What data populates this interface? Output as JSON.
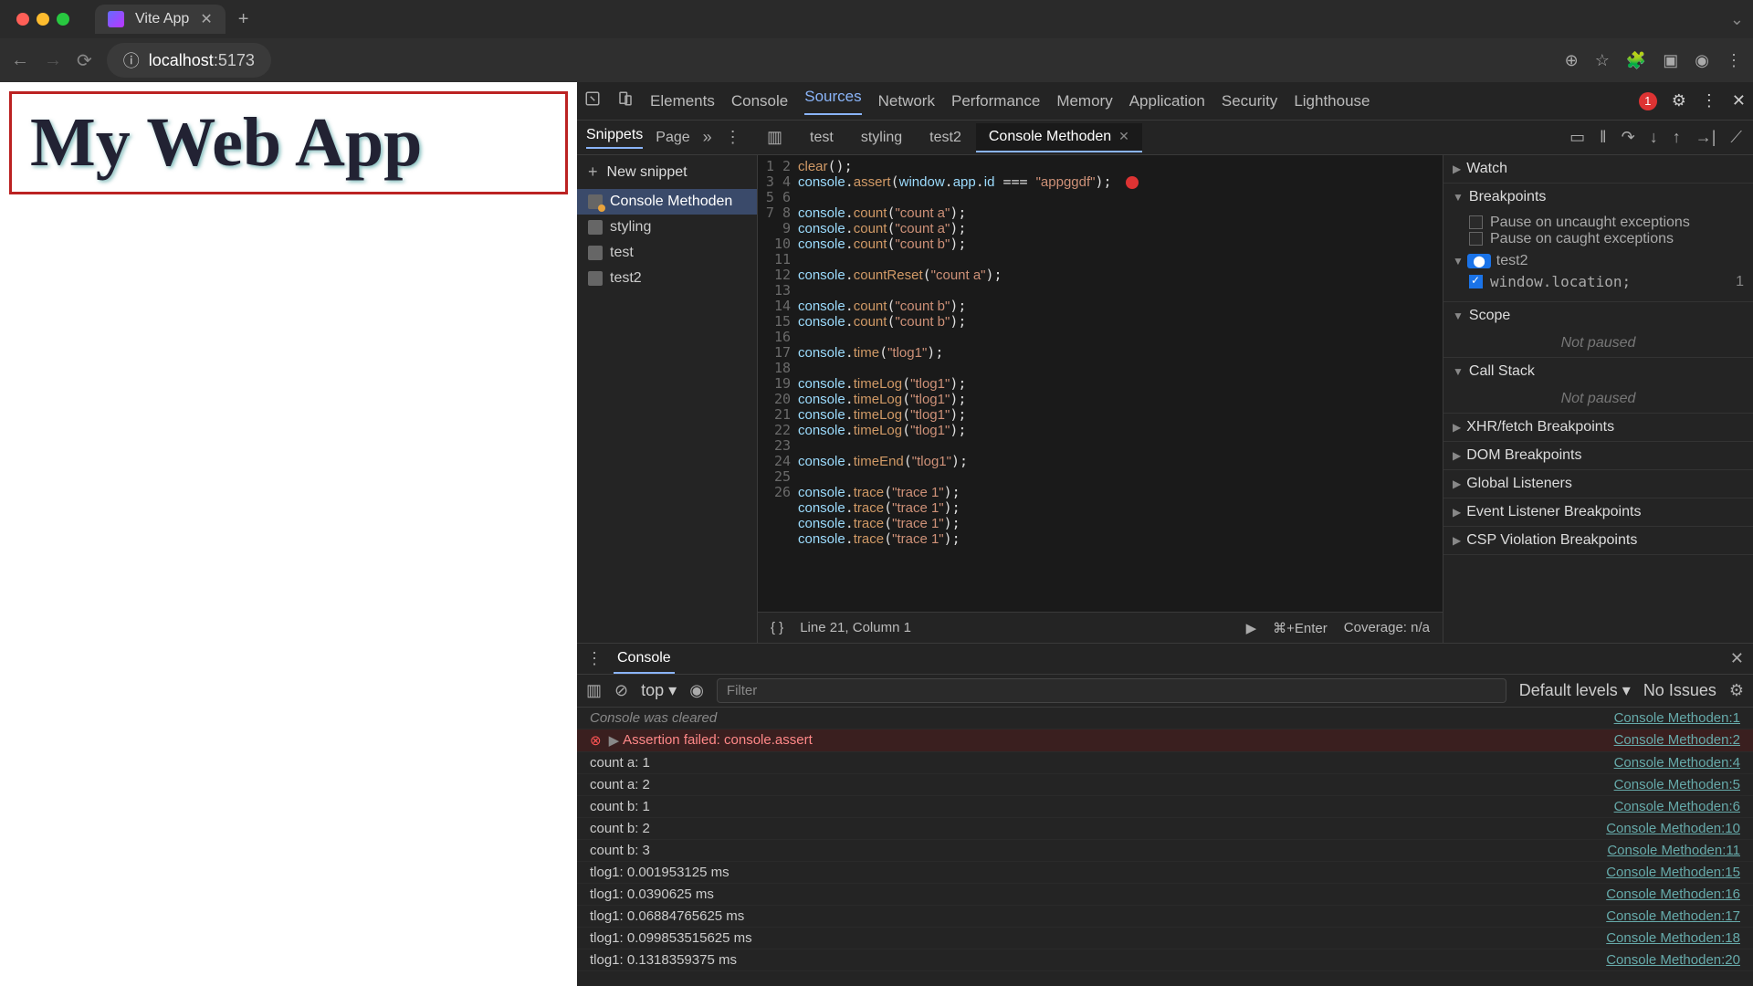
{
  "browser": {
    "tab_title": "Vite App",
    "url_prefix": "localhost",
    "url_suffix": ":5173"
  },
  "page": {
    "heading": "My Web App"
  },
  "devtools": {
    "tabs": [
      "Elements",
      "Console",
      "Sources",
      "Network",
      "Performance",
      "Memory",
      "Application",
      "Security",
      "Lighthouse"
    ],
    "active_tab": "Sources",
    "error_count": "1"
  },
  "sources": {
    "left_tabs": [
      "Snippets",
      "Page"
    ],
    "new_snippet": "New snippet",
    "snippets": [
      "Console Methoden",
      "styling",
      "test",
      "test2"
    ],
    "selected_snippet": "Console Methoden",
    "file_tabs": [
      "test",
      "styling",
      "test2",
      "Console Methoden"
    ],
    "active_file": "Console Methoden",
    "code_lines": [
      {
        "n": 1,
        "html": "<span class='tok-fn'>clear</span>();"
      },
      {
        "n": 2,
        "html": "<span class='tok-obj'>console</span>.<span class='tok-fn'>assert</span>(<span class='tok-obj'>window</span>.<span class='tok-obj'>app</span>.<span class='tok-obj'>id</span> === <span class='tok-str'>\"appggdf\"</span>); <span class='err-dot'></span>"
      },
      {
        "n": 3,
        "html": ""
      },
      {
        "n": 4,
        "html": "<span class='tok-obj'>console</span>.<span class='tok-fn'>count</span>(<span class='tok-str'>\"count a\"</span>);"
      },
      {
        "n": 5,
        "html": "<span class='tok-obj'>console</span>.<span class='tok-fn'>count</span>(<span class='tok-str'>\"count a\"</span>);"
      },
      {
        "n": 6,
        "html": "<span class='tok-obj'>console</span>.<span class='tok-fn'>count</span>(<span class='tok-str'>\"count b\"</span>);"
      },
      {
        "n": 7,
        "html": ""
      },
      {
        "n": 8,
        "html": "<span class='tok-obj'>console</span>.<span class='tok-fn'>countReset</span>(<span class='tok-str'>\"count a\"</span>);"
      },
      {
        "n": 9,
        "html": ""
      },
      {
        "n": 10,
        "html": "<span class='tok-obj'>console</span>.<span class='tok-fn'>count</span>(<span class='tok-str'>\"count b\"</span>);"
      },
      {
        "n": 11,
        "html": "<span class='tok-obj'>console</span>.<span class='tok-fn'>count</span>(<span class='tok-str'>\"count b\"</span>);"
      },
      {
        "n": 12,
        "html": ""
      },
      {
        "n": 13,
        "html": "<span class='tok-obj'>console</span>.<span class='tok-fn'>time</span>(<span class='tok-str'>\"tlog1\"</span>);"
      },
      {
        "n": 14,
        "html": ""
      },
      {
        "n": 15,
        "html": "<span class='tok-obj'>console</span>.<span class='tok-fn'>timeLog</span>(<span class='tok-str'>\"tlog1\"</span>);"
      },
      {
        "n": 16,
        "html": "<span class='tok-obj'>console</span>.<span class='tok-fn'>timeLog</span>(<span class='tok-str'>\"tlog1\"</span>);"
      },
      {
        "n": 17,
        "html": "<span class='tok-obj'>console</span>.<span class='tok-fn'>timeLog</span>(<span class='tok-str'>\"tlog1\"</span>);"
      },
      {
        "n": 18,
        "html": "<span class='tok-obj'>console</span>.<span class='tok-fn'>timeLog</span>(<span class='tok-str'>\"tlog1\"</span>);"
      },
      {
        "n": 19,
        "html": ""
      },
      {
        "n": 20,
        "html": "<span class='tok-obj'>console</span>.<span class='tok-fn'>timeEnd</span>(<span class='tok-str'>\"tlog1\"</span>);"
      },
      {
        "n": 21,
        "html": ""
      },
      {
        "n": 22,
        "html": "<span class='tok-obj'>console</span>.<span class='tok-fn'>trace</span>(<span class='tok-str'>\"trace 1\"</span>);"
      },
      {
        "n": 23,
        "html": "<span class='tok-obj'>console</span>.<span class='tok-fn'>trace</span>(<span class='tok-str'>\"trace 1\"</span>);"
      },
      {
        "n": 24,
        "html": "<span class='tok-obj'>console</span>.<span class='tok-fn'>trace</span>(<span class='tok-str'>\"trace 1\"</span>);"
      },
      {
        "n": 25,
        "html": "<span class='tok-obj'>console</span>.<span class='tok-fn'>trace</span>(<span class='tok-str'>\"trace 1\"</span>);"
      },
      {
        "n": 26,
        "html": ""
      }
    ],
    "status": {
      "braces": "{ }",
      "position": "Line 21, Column 1",
      "shortcut": "⌘+Enter",
      "coverage": "Coverage: n/a"
    }
  },
  "debugger": {
    "sections": {
      "watch": "Watch",
      "breakpoints": "Breakpoints",
      "pause_uncaught": "Pause on uncaught exceptions",
      "pause_caught": "Pause on caught exceptions",
      "bp_group": "test2",
      "bp_item_code": "window.location;",
      "bp_item_line": "1",
      "scope": "Scope",
      "callstack": "Call Stack",
      "not_paused": "Not paused",
      "xhr": "XHR/fetch Breakpoints",
      "dom": "DOM Breakpoints",
      "global": "Global Listeners",
      "event": "Event Listener Breakpoints",
      "csp": "CSP Violation Breakpoints"
    }
  },
  "console": {
    "tab": "Console",
    "context": "top",
    "filter_placeholder": "Filter",
    "levels": "Default levels",
    "issues": "No Issues",
    "rows": [
      {
        "type": "info",
        "msg": "Console was cleared",
        "src": "Console Methoden:1"
      },
      {
        "type": "err",
        "msg": "Assertion failed: console.assert",
        "src": "Console Methoden:2"
      },
      {
        "type": "log",
        "msg": "count a: 1",
        "src": "Console Methoden:4"
      },
      {
        "type": "log",
        "msg": "count a: 2",
        "src": "Console Methoden:5"
      },
      {
        "type": "log",
        "msg": "count b: 1",
        "src": "Console Methoden:6"
      },
      {
        "type": "log",
        "msg": "count b: 2",
        "src": "Console Methoden:10"
      },
      {
        "type": "log",
        "msg": "count b: 3",
        "src": "Console Methoden:11"
      },
      {
        "type": "log",
        "msg": "tlog1: 0.001953125 ms",
        "src": "Console Methoden:15"
      },
      {
        "type": "log",
        "msg": "tlog1: 0.0390625 ms",
        "src": "Console Methoden:16"
      },
      {
        "type": "log",
        "msg": "tlog1: 0.06884765625 ms",
        "src": "Console Methoden:17"
      },
      {
        "type": "log",
        "msg": "tlog1: 0.099853515625 ms",
        "src": "Console Methoden:18"
      },
      {
        "type": "log",
        "msg": "tlog1: 0.1318359375 ms",
        "src": "Console Methoden:20"
      }
    ]
  }
}
